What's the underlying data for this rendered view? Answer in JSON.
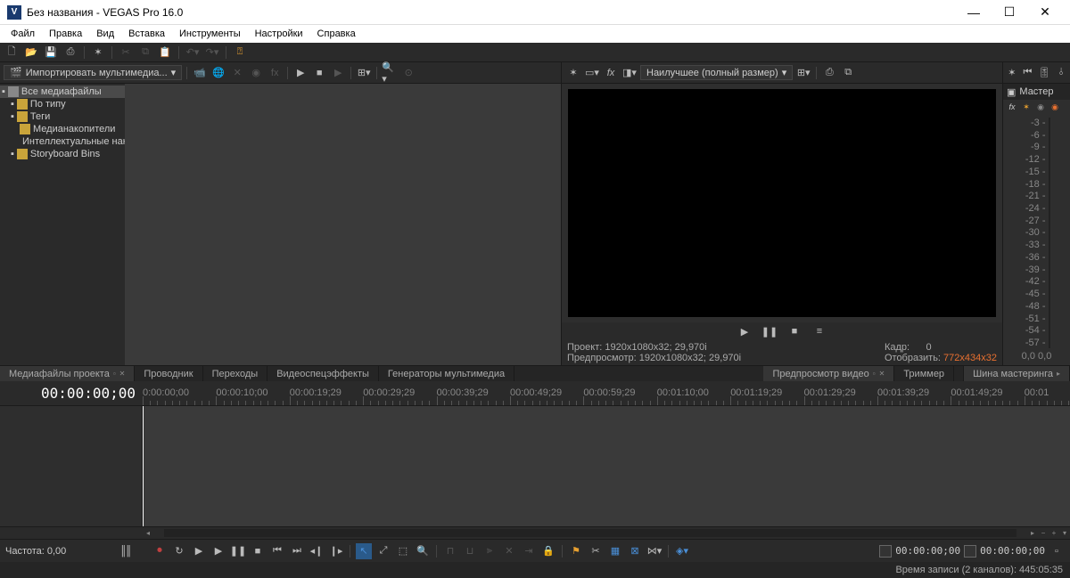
{
  "window": {
    "title": "Без названия - VEGAS Pro 16.0",
    "logo": "V"
  },
  "menu": [
    "Файл",
    "Правка",
    "Вид",
    "Вставка",
    "Инструменты",
    "Настройки",
    "Справка"
  ],
  "media": {
    "import_label": "Импортировать мультимедиа...",
    "tree": {
      "root": "Все медиафайлы",
      "items": [
        "По типу",
        "Теги",
        "Медианакопители",
        "Интеллектуальные нак",
        "Storyboard Bins"
      ]
    }
  },
  "tabs_left": [
    {
      "label": "Медиафайлы проекта",
      "active": true,
      "closable": true
    },
    {
      "label": "Проводник"
    },
    {
      "label": "Переходы"
    },
    {
      "label": "Видеоспецэффекты"
    },
    {
      "label": "Генераторы мультимедиа"
    }
  ],
  "preview": {
    "quality": "Наилучшее (полный размер)",
    "info": {
      "project_label": "Проект:",
      "project_val": "1920x1080x32; 29,970i",
      "preview_label": "Предпросмотр:",
      "preview_val": "1920x1080x32; 29,970i",
      "frame_label": "Кадр:",
      "frame_val": "0",
      "display_label": "Отобразить:",
      "display_val": "772x434x32"
    },
    "tabs": [
      {
        "label": "Предпросмотр видео",
        "active": true,
        "closable": true
      },
      {
        "label": "Триммер"
      }
    ]
  },
  "master": {
    "title": "Мастер",
    "scale": [
      "-3 -",
      "-6 -",
      "-9 -",
      "-12 -",
      "-15 -",
      "-18 -",
      "-21 -",
      "-24 -",
      "-27 -",
      "-30 -",
      "-33 -",
      "-36 -",
      "-39 -",
      "-42 -",
      "-45 -",
      "-48 -",
      "-51 -",
      "-54 -",
      "-57 -"
    ],
    "reading": "0,0   0,0",
    "tab": "Шина мастеринга"
  },
  "timeline": {
    "timecode": "00:00:00;00",
    "ruler": [
      "0:00:00;00",
      "00:00:10;00",
      "00:00:19;29",
      "00:00:29;29",
      "00:00:39;29",
      "00:00:49;29",
      "00:00:59;29",
      "00:01:10;00",
      "00:01:19;29",
      "00:01:29;29",
      "00:01:39;29",
      "00:01:49;29",
      "00:01"
    ],
    "rate_label": "Частота: 0,00",
    "end_time": "00:00:00;00",
    "end_time2": "00:00:00;00"
  },
  "status": {
    "rec": "Время записи (2 каналов): 445:05:35"
  }
}
